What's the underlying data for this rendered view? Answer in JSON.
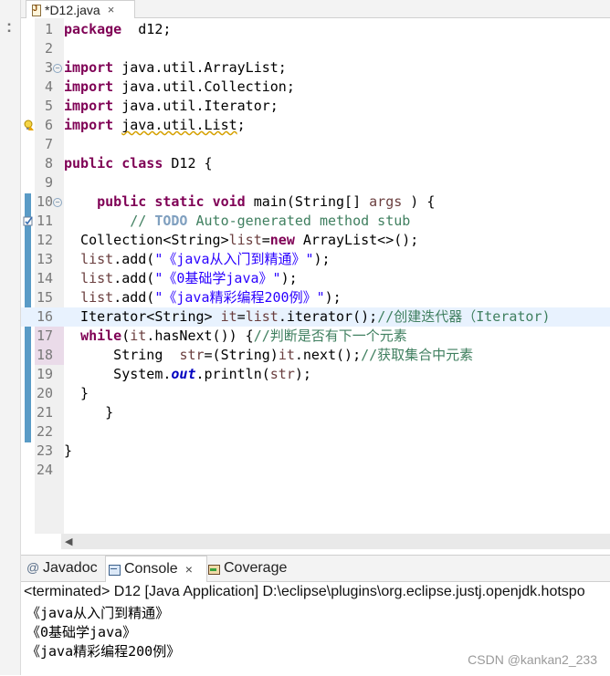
{
  "editor": {
    "tab_title": "*D12.java",
    "tab_close": "×",
    "lines": [
      {
        "n": "1",
        "segs": [
          [
            "kw",
            "package"
          ],
          [
            "",
            "  d12;"
          ]
        ]
      },
      {
        "n": "2",
        "segs": []
      },
      {
        "n": "3",
        "fold": true,
        "segs": [
          [
            "kw",
            "import"
          ],
          [
            "",
            " java.util.ArrayList;"
          ]
        ]
      },
      {
        "n": "4",
        "segs": [
          [
            "kw",
            "import"
          ],
          [
            "",
            " java.util.Collection;"
          ]
        ]
      },
      {
        "n": "5",
        "segs": [
          [
            "kw",
            "import"
          ],
          [
            "",
            " java.util.Iterator;"
          ]
        ]
      },
      {
        "n": "6",
        "marker": "warning",
        "segs": [
          [
            "kw",
            "import"
          ],
          [
            "",
            " "
          ],
          [
            "warn",
            "java.util.List"
          ],
          [
            "",
            ";"
          ]
        ]
      },
      {
        "n": "7",
        "segs": []
      },
      {
        "n": "8",
        "segs": [
          [
            "kw",
            "public"
          ],
          [
            "",
            " "
          ],
          [
            "kw",
            "class"
          ],
          [
            "",
            " D12 {"
          ]
        ]
      },
      {
        "n": "9",
        "segs": []
      },
      {
        "n": "10",
        "fold": true,
        "segs": [
          [
            "",
            "    "
          ],
          [
            "kw",
            "public"
          ],
          [
            "",
            " "
          ],
          [
            "kw",
            "static"
          ],
          [
            "",
            " "
          ],
          [
            "kw",
            "void"
          ],
          [
            "",
            " main(String[] "
          ],
          [
            "var",
            "args"
          ],
          [
            "",
            " ) {"
          ]
        ]
      },
      {
        "n": "11",
        "marker": "task",
        "segs": [
          [
            "",
            "        "
          ],
          [
            "cm",
            "// "
          ],
          [
            "todo",
            "TODO"
          ],
          [
            "cm",
            " Auto-generated method stub"
          ]
        ]
      },
      {
        "n": "12",
        "segs": [
          [
            "",
            "  Collection<String>"
          ],
          [
            "var",
            "list"
          ],
          [
            "",
            "="
          ],
          [
            "kw",
            "new"
          ],
          [
            "",
            " ArrayList<>();"
          ]
        ]
      },
      {
        "n": "13",
        "segs": [
          [
            "",
            "  "
          ],
          [
            "var",
            "list"
          ],
          [
            "",
            ".add("
          ],
          [
            "str",
            "\"《java从入门到精通》\""
          ],
          [
            "",
            ");"
          ]
        ]
      },
      {
        "n": "14",
        "segs": [
          [
            "",
            "  "
          ],
          [
            "var",
            "list"
          ],
          [
            "",
            ".add("
          ],
          [
            "str",
            "\"《0基础学java》\""
          ],
          [
            "",
            ");"
          ]
        ]
      },
      {
        "n": "15",
        "segs": [
          [
            "",
            "  "
          ],
          [
            "var",
            "list"
          ],
          [
            "",
            ".add("
          ],
          [
            "str",
            "\"《java精彩编程200例》\""
          ],
          [
            "",
            ");"
          ]
        ]
      },
      {
        "n": "16",
        "current": true,
        "segs": [
          [
            "",
            "  Iterator<String> "
          ],
          [
            "var",
            "it"
          ],
          [
            "",
            "="
          ],
          [
            "var",
            "list"
          ],
          [
            "",
            ".iterator();"
          ],
          [
            "cm",
            "//创建迭代器（Iterator)"
          ]
        ]
      },
      {
        "n": "17",
        "segs": [
          [
            "",
            "  "
          ],
          [
            "kw",
            "while"
          ],
          [
            "",
            "("
          ],
          [
            "var",
            "it"
          ],
          [
            "",
            ".hasNext()) {"
          ],
          [
            "cm",
            "//判断是否有下一个元素"
          ]
        ]
      },
      {
        "n": "18",
        "segs": [
          [
            "",
            "      String  "
          ],
          [
            "var",
            "str"
          ],
          [
            "",
            "=(String)"
          ],
          [
            "var",
            "it"
          ],
          [
            "",
            ".next();"
          ],
          [
            "cm",
            "//获取集合中元素"
          ]
        ]
      },
      {
        "n": "19",
        "segs": [
          [
            "",
            "      System."
          ],
          [
            "fld",
            "out"
          ],
          [
            "",
            ".println("
          ],
          [
            "var",
            "str"
          ],
          [
            "",
            ");"
          ]
        ]
      },
      {
        "n": "20",
        "segs": [
          [
            "",
            "  }"
          ]
        ]
      },
      {
        "n": "21",
        "segs": [
          [
            "",
            "     }"
          ]
        ]
      },
      {
        "n": "22",
        "segs": []
      },
      {
        "n": "23",
        "segs": [
          [
            "",
            "}"
          ]
        ]
      },
      {
        "n": "24",
        "segs": []
      }
    ]
  },
  "console": {
    "tabs": [
      {
        "label": "Javadoc",
        "icon": "javadoc-icon"
      },
      {
        "label": "Console",
        "icon": "console-icon",
        "close": "×"
      },
      {
        "label": "Coverage",
        "icon": "coverage-icon"
      }
    ],
    "status": "<terminated> D12 [Java Application] D:\\eclipse\\plugins\\org.eclipse.justj.openjdk.hotspo",
    "output": [
      "《java从入门到精通》",
      "《0基础学java》",
      "《java精彩编程200例》"
    ]
  },
  "watermark": "CSDN @kankan2_233",
  "colors": {
    "keyword": "#7f0055",
    "string": "#2a00ff",
    "comment": "#3f7f5f",
    "change_bar": "#5a9bc6",
    "current_line": "#e8f2fe"
  }
}
